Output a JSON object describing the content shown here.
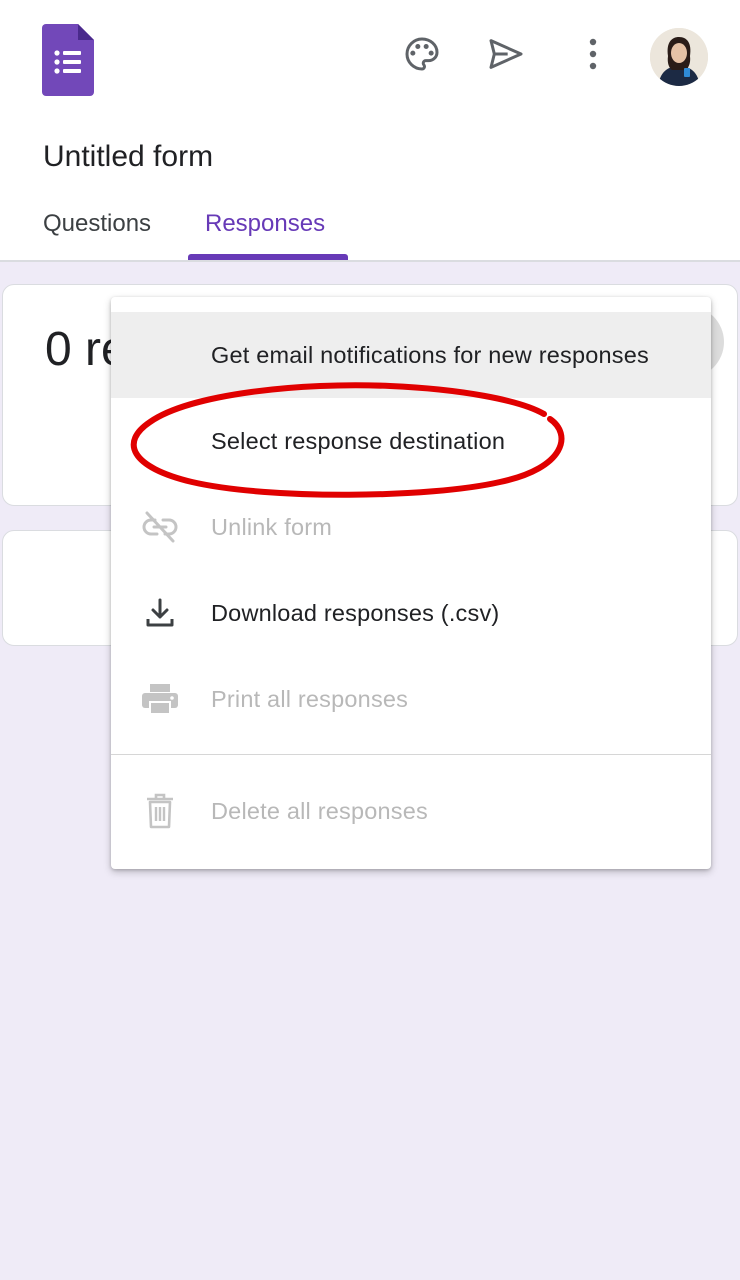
{
  "header": {
    "logo": "google-forms-icon",
    "actions": [
      {
        "icon": "palette-icon",
        "label": "Customize theme"
      },
      {
        "icon": "send-icon",
        "label": "Send"
      },
      {
        "icon": "more-vert-icon",
        "label": "More options"
      }
    ],
    "avatar": "user-avatar"
  },
  "form": {
    "title": "Untitled form"
  },
  "tabs": [
    {
      "label": "Questions",
      "active": false
    },
    {
      "label": "Responses",
      "active": true
    }
  ],
  "responses": {
    "count_text": "0 re"
  },
  "menu": {
    "items": [
      {
        "label": "Get email notifications for new responses",
        "icon": "",
        "enabled": true,
        "highlighted": true
      },
      {
        "label": "Select response destination",
        "icon": "",
        "enabled": true,
        "highlighted": false
      },
      {
        "label": "Unlink form",
        "icon": "link-off-icon",
        "enabled": false
      },
      {
        "label": "Download responses (.csv)",
        "icon": "download-icon",
        "enabled": true
      },
      {
        "label": "Print all responses",
        "icon": "print-icon",
        "enabled": false
      },
      {
        "label": "Delete all responses",
        "icon": "trash-icon",
        "enabled": false
      }
    ]
  },
  "colors": {
    "accent": "#673ab7",
    "background": "#efebf7",
    "annotation": "#e00000",
    "disabled_text": "#b8b8b8"
  }
}
